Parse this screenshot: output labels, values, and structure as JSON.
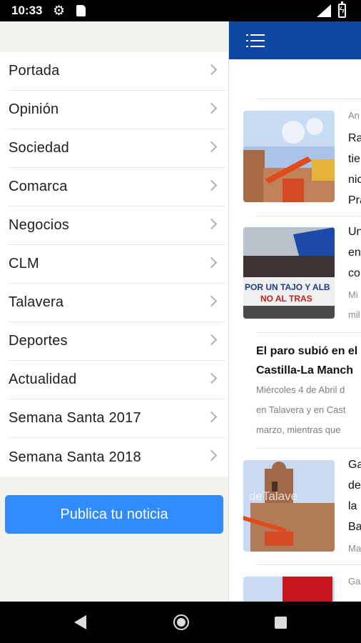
{
  "status_bar": {
    "time": "10:33",
    "network": "LTE"
  },
  "drawer": {
    "menu": [
      {
        "label": "Portada"
      },
      {
        "label": "Opinión"
      },
      {
        "label": "Sociedad"
      },
      {
        "label": "Comarca"
      },
      {
        "label": "Negocios"
      },
      {
        "label": "CLM"
      },
      {
        "label": "Talavera"
      },
      {
        "label": "Deportes"
      },
      {
        "label": "Actualidad"
      },
      {
        "label": "Semana Santa 2017"
      },
      {
        "label": "Semana Santa 2018"
      }
    ],
    "publish_button": "Publica tu noticia"
  },
  "articles": [
    {
      "meta": "An",
      "lines": [
        "Ra",
        "tie",
        "nic",
        "Pra"
      ]
    },
    {
      "lines": [
        "Un",
        "en",
        "co"
      ],
      "meta_lines": [
        "Mi",
        "mil"
      ]
    },
    {
      "title_lines": [
        "El paro subió en el",
        "Castilla-La Manch"
      ],
      "meta_lines": [
        "Miércoles 4 de Abril d",
        "en Talavera y en Cast",
        "marzo, mientras que"
      ]
    },
    {
      "lines": [
        "Ga",
        "de",
        "la",
        "Ba"
      ],
      "meta_lines": [
        "Ma"
      ],
      "watermark": "deTalave"
    },
    {
      "meta": "Ga"
    }
  ],
  "colors": {
    "appbar": "#0d47a1",
    "publish_button": "#2f8cff",
    "drawer_bg": "#f3f2ee"
  }
}
